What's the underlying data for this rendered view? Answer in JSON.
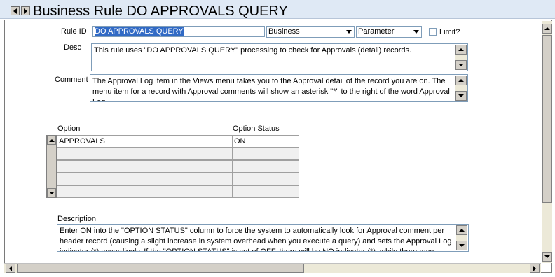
{
  "window": {
    "title": "Business Rule DO APPROVALS QUERY"
  },
  "form": {
    "rule_id_label": "Rule ID",
    "rule_id_value": "DO APPROVALS QUERY",
    "type_value": "Business",
    "kind_value": "Parameter",
    "limit_label": "Limit?",
    "desc_label": "Desc",
    "desc_value": "This rule uses \"DO APPROVALS QUERY\" processing to check for Approvals (detail) records.",
    "comment_label": "Comment",
    "comment_value": "The Approval Log item in the Views menu takes you to the Approval detail of the record you are on. The menu item for a record with Approval comments will show an asterisk \"*\" to the right of the word Approval Log.",
    "description_label": "Description",
    "description_value": "Enter ON into the \"OPTION STATUS\" column to force the system to automatically look for Approval comment per header record (causing a slight increase in system overhead when you execute a query) and sets the Approval Log indicator (*) accordingly. If the \"OPTION STATUS\" is set of OFF, there will be NO indicator (*), while there may..."
  },
  "grid": {
    "columns": [
      "Option",
      "Option Status"
    ],
    "rows": [
      {
        "option": "APPROVALS",
        "status": "ON"
      },
      {
        "option": "",
        "status": ""
      },
      {
        "option": "",
        "status": ""
      },
      {
        "option": "",
        "status": ""
      },
      {
        "option": "",
        "status": ""
      }
    ]
  },
  "icons": [
    "left-arrow-icon",
    "right-arrow-icon",
    "scroll-up-icon",
    "scroll-down-icon",
    "dropdown-arrow-icon"
  ],
  "colors": {
    "title_bar": "#dfe9f5",
    "selection": "#316ac5",
    "grid_empty": "#f0f0f0"
  }
}
